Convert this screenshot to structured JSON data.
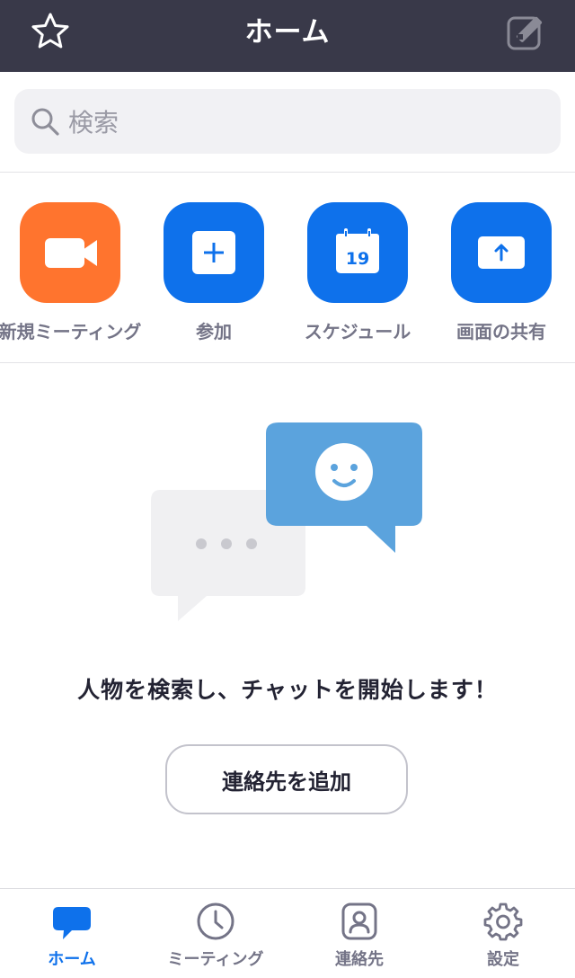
{
  "header": {
    "title": "ホーム",
    "favorite_icon": "star-icon",
    "compose_icon": "edit-icon"
  },
  "search": {
    "placeholder": "検索",
    "icon": "search-icon"
  },
  "actions": [
    {
      "label": "新規ミーティング",
      "icon": "video-camera-icon",
      "color": "#ff742e"
    },
    {
      "label": "参加",
      "icon": "plus-icon",
      "color": "#0e71eb"
    },
    {
      "label": "スケジュール",
      "icon": "calendar-icon",
      "color": "#0e71eb",
      "calendar_day": "19"
    },
    {
      "label": "画面の共有",
      "icon": "share-screen-icon",
      "color": "#0e71eb"
    }
  ],
  "empty_state": {
    "illustration": "chat-bubbles-illustration",
    "message": "人物を検索し、チャットを開始します！",
    "button_label": "連絡先を追加"
  },
  "tabs": [
    {
      "label": "ホーム",
      "icon": "chat-bubble-icon",
      "active": true
    },
    {
      "label": "ミーティング",
      "icon": "clock-icon",
      "active": false
    },
    {
      "label": "連絡先",
      "icon": "contact-icon",
      "active": false
    },
    {
      "label": "設定",
      "icon": "gear-icon",
      "active": false
    }
  ],
  "colors": {
    "header_bg": "#393949",
    "accent": "#0e71eb",
    "orange": "#ff742e",
    "inactive_text": "#747487"
  }
}
